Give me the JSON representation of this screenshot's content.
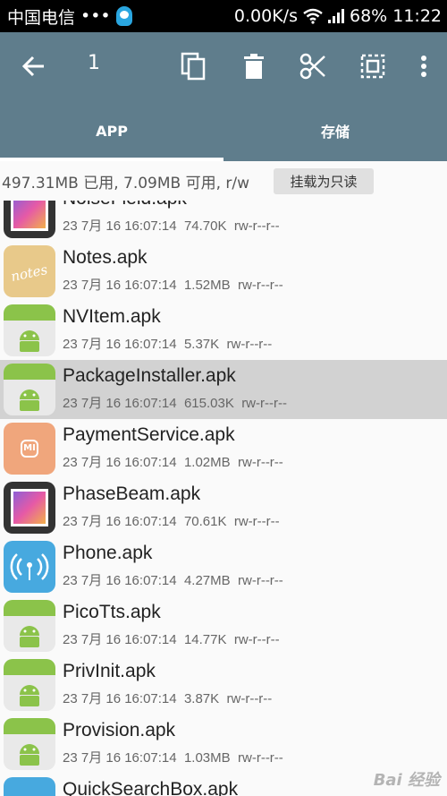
{
  "status_bar": {
    "carrier": "中国电信",
    "dots": "•••",
    "speed": "0.00K/s",
    "battery": "68%",
    "time": "11:22"
  },
  "action_bar": {
    "selected_count": "1",
    "icons": [
      "back-arrow-icon",
      "copy-icon",
      "delete-icon",
      "cut-icon",
      "select-all-icon",
      "more-vert-icon"
    ]
  },
  "tabs": [
    {
      "label": "APP",
      "active": true
    },
    {
      "label": "存储",
      "active": false
    }
  ],
  "storage": {
    "info": "497.31MB 已用, 7.09MB 可用, r/w",
    "mount_button": "挂载为只读"
  },
  "files": [
    {
      "name": "NoiseField.apk",
      "date": "23 7月 16 16:07:14",
      "size": "74.70K",
      "perm": "rw-r--r--",
      "icon": "gallery"
    },
    {
      "name": "Notes.apk",
      "date": "23 7月 16 16:07:14",
      "size": "1.52MB",
      "perm": "rw-r--r--",
      "icon": "notes"
    },
    {
      "name": "NVItem.apk",
      "date": "23 7月 16 16:07:14",
      "size": "5.37K",
      "perm": "rw-r--r--",
      "icon": "android"
    },
    {
      "name": "PackageInstaller.apk",
      "date": "23 7月 16 16:07:14",
      "size": "615.03K",
      "perm": "rw-r--r--",
      "icon": "android",
      "selected": true
    },
    {
      "name": "PaymentService.apk",
      "date": "23 7月 16 16:07:14",
      "size": "1.02MB",
      "perm": "rw-r--r--",
      "icon": "payment"
    },
    {
      "name": "PhaseBeam.apk",
      "date": "23 7月 16 16:07:14",
      "size": "70.61K",
      "perm": "rw-r--r--",
      "icon": "gallery"
    },
    {
      "name": "Phone.apk",
      "date": "23 7月 16 16:07:14",
      "size": "4.27MB",
      "perm": "rw-r--r--",
      "icon": "phone"
    },
    {
      "name": "PicoTts.apk",
      "date": "23 7月 16 16:07:14",
      "size": "14.77K",
      "perm": "rw-r--r--",
      "icon": "android"
    },
    {
      "name": "PrivInit.apk",
      "date": "23 7月 16 16:07:14",
      "size": "3.87K",
      "perm": "rw-r--r--",
      "icon": "android"
    },
    {
      "name": "Provision.apk",
      "date": "23 7月 16 16:07:14",
      "size": "1.03MB",
      "perm": "rw-r--r--",
      "icon": "android"
    },
    {
      "name": "QuickSearchBox.apk",
      "date": "",
      "size": "",
      "perm": "",
      "icon": "phone"
    }
  ],
  "notes_icon_text": "notes",
  "payment_icon_text": "MI",
  "watermark": "Bai 经验",
  "colors": {
    "toolbar": "#5f7d8c",
    "selection": "#d2d2d2",
    "android_green": "#8bc34a"
  }
}
